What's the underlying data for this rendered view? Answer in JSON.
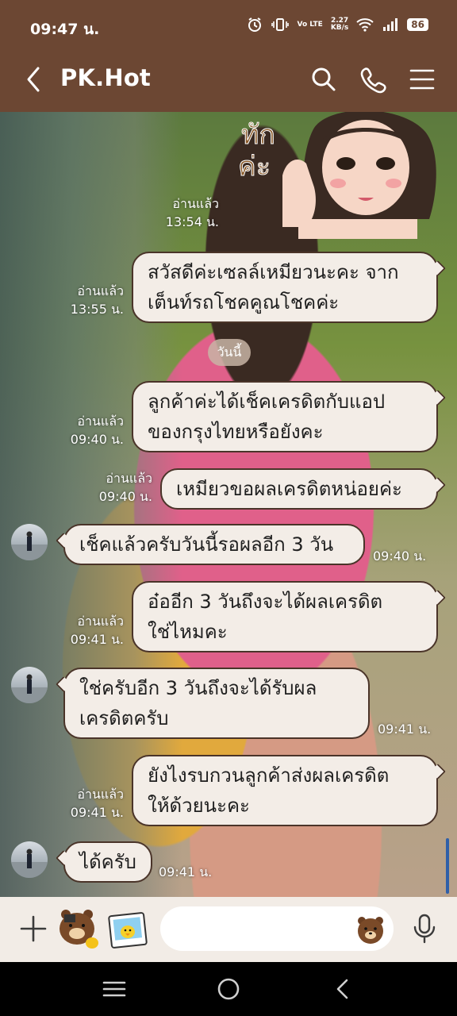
{
  "status_bar": {
    "time": "09:47 น.",
    "net_speed_top": "2.27",
    "net_speed_bottom": "KB/s",
    "volte": "Vo LTE",
    "battery": "86"
  },
  "header": {
    "title": "PK.Hot",
    "background": "#6c4733"
  },
  "chat": {
    "sticker_meta": {
      "read": "อ่านแล้ว",
      "time": "13:54 น."
    },
    "date_divider": "วันนี้",
    "messages": [
      {
        "id": 1,
        "direction": "out",
        "lines": [
          "สวัสดีค่ะเซลล์เหมียวนะคะ จาก",
          "เต็นท์รถโชคคูณโชคค่ะ"
        ],
        "read": "อ่านแล้ว",
        "time": "13:55 น."
      },
      {
        "id": 2,
        "direction": "out",
        "lines": [
          "ลูกค้าค่ะได้เช็คเครดิตกับแอป",
          "ของกรุงไทยหรือยังคะ"
        ],
        "read": "อ่านแล้ว",
        "time": "09:40 น."
      },
      {
        "id": 3,
        "direction": "out",
        "lines": [
          "เหมียวขอผลเครดิตหน่อยค่ะ"
        ],
        "read": "อ่านแล้ว",
        "time": "09:40 น."
      },
      {
        "id": 4,
        "direction": "in",
        "lines": [
          "เช็คแล้วครับวันนี้รอผลอีก 3 วัน"
        ],
        "time": "09:40 น."
      },
      {
        "id": 5,
        "direction": "out",
        "lines": [
          "อ๋ออีก 3 วันถึงจะได้ผลเครดิต",
          "ใช่ไหมคะ"
        ],
        "read": "อ่านแล้ว",
        "time": "09:41 น."
      },
      {
        "id": 6,
        "direction": "in",
        "lines": [
          "ใช่ครับอีก 3 วันถึงจะได้รับผล",
          "เครดิตครับ"
        ],
        "time": "09:41 น."
      },
      {
        "id": 7,
        "direction": "out",
        "lines": [
          "ยังไงรบกวนลูกค้าส่งผลเครดิต",
          "ให้ด้วยนะคะ"
        ],
        "read": "อ่านแล้ว",
        "time": "09:41 น."
      },
      {
        "id": 8,
        "direction": "in",
        "lines": [
          "ได้ครับ"
        ],
        "time": "09:41 น."
      }
    ]
  },
  "input_bar": {
    "placeholder": ""
  },
  "icons": {
    "back": "back-arrow-icon",
    "search": "search-icon",
    "call": "phone-icon",
    "menu": "menu-icon",
    "plus": "plus-icon",
    "sticker": "sticker-icon",
    "photo": "photo-icon",
    "emoji": "emoji-bear-icon",
    "mic": "microphone-icon"
  }
}
